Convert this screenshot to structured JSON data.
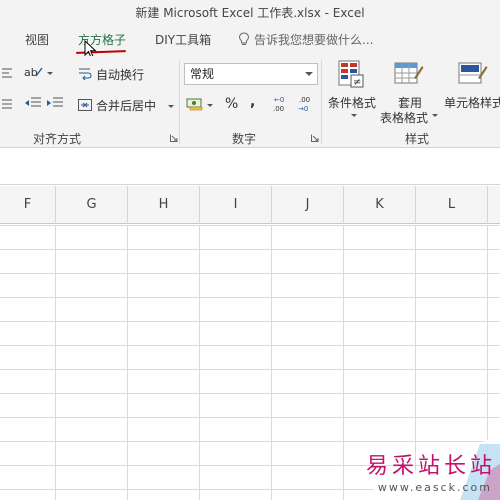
{
  "window": {
    "title": "新建 Microsoft Excel 工作表.xlsx - Excel"
  },
  "tabs": [
    {
      "label": "视图"
    },
    {
      "label": "方方格子"
    },
    {
      "label": "DIY工具箱"
    }
  ],
  "tell_me": {
    "placeholder": "告诉我您想要做什么..."
  },
  "ribbon": {
    "alignment": {
      "wrap_text_label": "自动换行",
      "merge_center_label": "合并后居中",
      "group_label": "对齐方式"
    },
    "number": {
      "format_value": "常规",
      "percent_symbol": "%",
      "comma_symbol": ",",
      "inc_decimal_label": "←0 .00",
      "dec_decimal_label": ".00 →0",
      "group_label": "数字"
    },
    "styles": {
      "conditional_format_label": "条件格式",
      "table_format_label_line1": "套用",
      "table_format_label_line2": "表格格式",
      "cell_styles_label": "单元格样式",
      "group_label": "样式"
    }
  },
  "columns": [
    "F",
    "G",
    "H",
    "I",
    "J",
    "K",
    "L"
  ],
  "watermark": {
    "text": "易采站长站",
    "url": "www.easck.com"
  },
  "colors": {
    "accent": "#217346",
    "underline": "#c00000",
    "watermark": "#c4126b"
  }
}
